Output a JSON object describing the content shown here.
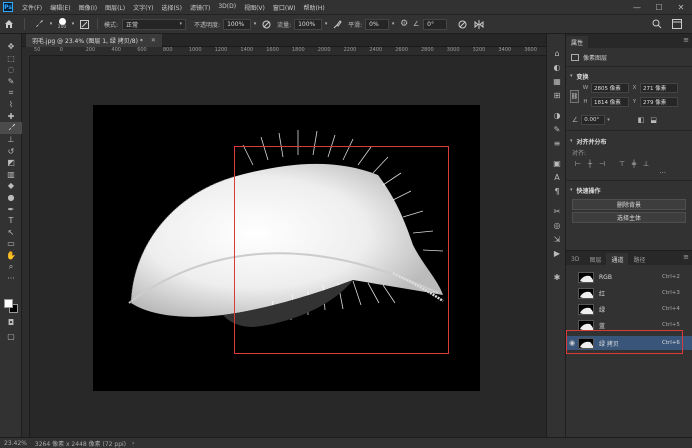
{
  "app": {
    "logo": "Ps"
  },
  "menu": [
    "文件(F)",
    "编辑(E)",
    "图像(I)",
    "图层(L)",
    "文字(Y)",
    "选择(S)",
    "滤镜(T)",
    "3D(D)",
    "视图(V)",
    "窗口(W)",
    "帮助(H)"
  ],
  "window_controls": {
    "minimize": "—",
    "maximize": "☐",
    "close": "✕"
  },
  "options_bar": {
    "brush_size": "200",
    "mode_label": "模式:",
    "mode_value": "正常",
    "opacity_label": "不透明度:",
    "opacity_value": "100%",
    "flow_label": "流量:",
    "flow_value": "100%",
    "smoothing_label": "平滑:",
    "smoothing_value": "0%",
    "angle_value": "0°"
  },
  "document": {
    "tab_title": "羽毛.jpg @ 23.4% (图层 1, 绿 拷贝/8) *",
    "close": "✕"
  },
  "ruler_ticks": [
    "50",
    "0",
    "200",
    "400",
    "600",
    "800",
    "1000",
    "1200",
    "1400",
    "1600",
    "1800",
    "2000",
    "2200",
    "2400",
    "2600",
    "2800",
    "3000",
    "3200",
    "3400",
    "3600"
  ],
  "status": {
    "zoom": "23.42%",
    "doc_info": "3264 像素 x 2448 像素 (72 ppi)",
    "arrow": "›"
  },
  "properties": {
    "tab": "属性",
    "layer_type": "像素图层",
    "transform_title": "变换",
    "w_label": "W",
    "w_value": "2805 像素",
    "h_label": "H",
    "h_value": "1814 像素",
    "x_label": "X",
    "x_value": "271 像素",
    "y_label": "Y",
    "y_value": "279 像素",
    "angle_value": "0.00°",
    "align_title": "对齐并分布",
    "align_label": "对齐:",
    "quick_title": "快速操作",
    "btn_remove_bg": "删除背景",
    "btn_select_subject": "选择主体",
    "more": "···"
  },
  "channels_panel": {
    "tabs": [
      "3D",
      "图层",
      "通道",
      "路径"
    ],
    "active_tab": "通道",
    "rows": [
      {
        "name": "RGB",
        "key": "Ctrl+2",
        "selected": false,
        "visible": false
      },
      {
        "name": "红",
        "key": "Ctrl+3",
        "selected": false,
        "visible": false
      },
      {
        "name": "绿",
        "key": "Ctrl+4",
        "selected": false,
        "visible": false
      },
      {
        "name": "蓝",
        "key": "Ctrl+5",
        "selected": false,
        "visible": false
      },
      {
        "name": "绿 拷贝",
        "key": "Ctrl+6",
        "selected": true,
        "visible": true
      }
    ]
  },
  "colors": {
    "ui_dark": "#282828",
    "ui_panel": "#323232",
    "selection_red": "#d93a3a",
    "channel_selected": "#39567a",
    "ps_blue": "#31a8ff"
  }
}
